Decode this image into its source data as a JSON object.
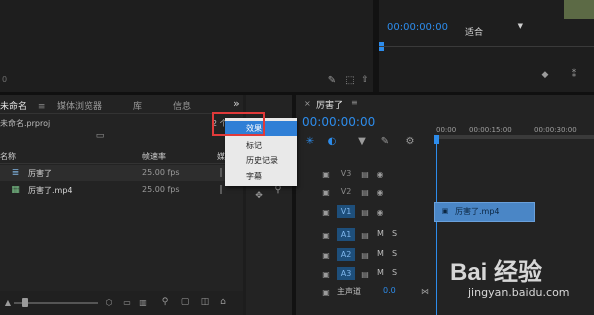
{
  "source_monitor": {
    "time_readout": "0"
  },
  "program_monitor": {
    "timecode": "00:00:00:00",
    "fit_dropdown": "适合"
  },
  "project_panel": {
    "tabs": [
      "未命名",
      "媒体浏览器",
      "库",
      "信息"
    ],
    "overflow_chevron": "»",
    "file_name": "未命名.prproj",
    "item_count": "2 个",
    "headers": {
      "name": "名称",
      "framerate": "帧速率",
      "more": "媒"
    },
    "items": [
      {
        "name": "厉害了",
        "fps": "25.00 fps",
        "kind": "sequence"
      },
      {
        "name": "厉害了.mp4",
        "fps": "25.00 fps",
        "kind": "clip"
      }
    ]
  },
  "panel_menu": {
    "items": [
      "效果",
      "标记",
      "历史记录",
      "字幕"
    ],
    "highlighted": "效果"
  },
  "timeline": {
    "sequence_tab": "厉害了",
    "timecode": "00:00:00:00",
    "ruler": [
      "00:00",
      "00:00:15:00",
      "00:00:30:00"
    ],
    "video_tracks": [
      "V3",
      "V2",
      "V1"
    ],
    "audio_tracks": [
      "A1",
      "A2",
      "A3"
    ],
    "master_label": "主声道",
    "master_value": "0.0",
    "mute_label": "M",
    "solo_label": "S",
    "clip_label": "厉害了.mp4"
  },
  "watermark": {
    "brand": "Bai 经验",
    "url": "jingyan.baidu.com"
  },
  "colors": {
    "accent": "#2d8ceb",
    "clip": "#4a86c6",
    "highlight_border": "#e03a3a",
    "menu_bg": "#e9e9e9",
    "menu_selected": "#2f7fd6"
  }
}
